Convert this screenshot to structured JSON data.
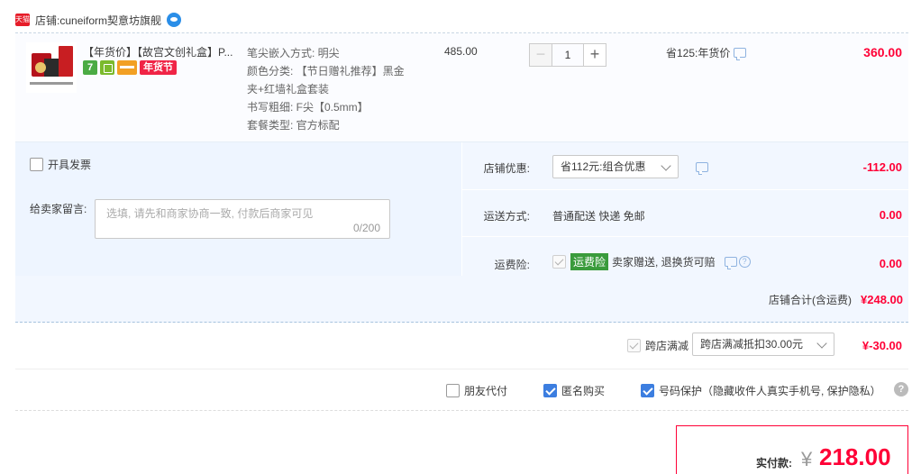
{
  "store": {
    "badge": "天猫",
    "prefix": "店铺: ",
    "name": "cuneiform契意坊旗舰"
  },
  "item": {
    "title": "【年货价】【故宫文创礼盒】P...",
    "badges": {
      "seven": "7",
      "nian": "年货节"
    },
    "specs": [
      "笔尖嵌入方式: 明尖",
      "颜色分类: 【节日赠礼推荐】黑金",
      "夹+红墙礼盒套装",
      "书写粗细: F尖【0.5mm】",
      "套餐类型: 官方标配"
    ],
    "unit_price": "485.00",
    "quantity": "1",
    "minus": "−",
    "plus": "+",
    "saved": "省125:年货价",
    "total": "360.00"
  },
  "invoice": {
    "label": "开具发票"
  },
  "message": {
    "label": "给卖家留言:",
    "placeholder": "选填, 请先和商家协商一致, 付款后商家可见",
    "count": "0/200"
  },
  "discount": {
    "label": "店铺优惠:",
    "selected": "省112元:组合优惠",
    "value": "-112.00"
  },
  "shipping": {
    "label": "运送方式:",
    "text": "普通配送 快递 免邮",
    "value": "0.00"
  },
  "insurance": {
    "label": "运费险:",
    "tag": "运费险",
    "text": "卖家赠送, 退换货可赔",
    "value": "0.00"
  },
  "store_total": {
    "label": "店铺合计(含运费)",
    "value": "¥248.00"
  },
  "cross_store": {
    "label": "跨店满减",
    "selected": "跨店满减抵扣30.00元",
    "value": "¥-30.00"
  },
  "options": {
    "friend_pay": "朋友代付",
    "anonymous": "匿名购买",
    "number_protect": "号码保护（隐藏收件人真实手机号, 保护隐私）"
  },
  "payment": {
    "label": "实付款:",
    "currency": "¥",
    "amount": "218.00"
  },
  "colors": {
    "price_red": "#ff0036",
    "panel_blue": "#f2f7ff",
    "check_blue": "#3c7ee0",
    "insurance_green": "#3a9b3c"
  }
}
